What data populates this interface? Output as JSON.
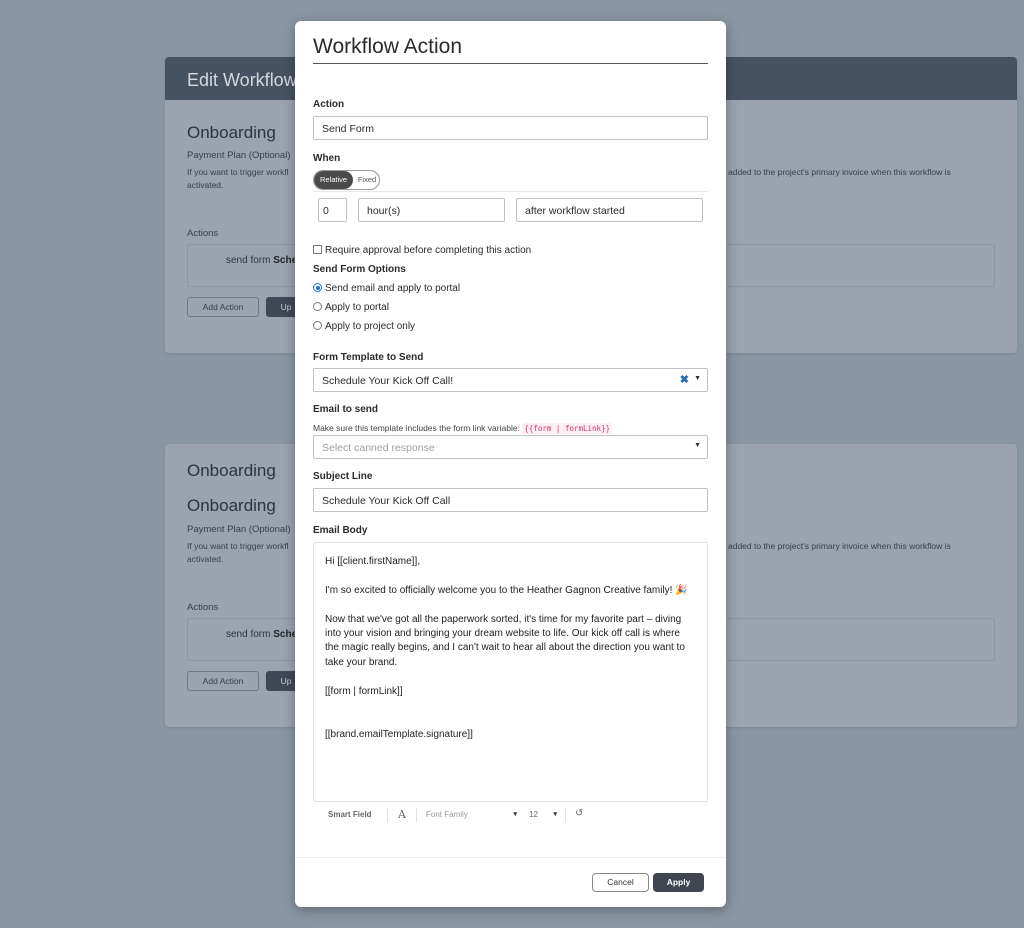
{
  "background": {
    "header_title": "Edit Workflow",
    "card1": {
      "title": "Onboarding",
      "payment_label": "Payment Plan (Optional)",
      "help_left_1": "If you want to trigger workfl",
      "help_left_2": "activated.",
      "help_right": "added to the project's primary invoice when this workflow is",
      "actions_label": "Actions",
      "action_prefix": "send form",
      "action_name": "Sche",
      "add_action": "Add Action",
      "update_button": "Up"
    },
    "card2": {
      "title_top": "Onboarding",
      "title": "Onboarding",
      "payment_label": "Payment Plan (Optional)",
      "help_left_1": "If you want to trigger workfl",
      "help_left_2": "activated.",
      "help_right": "added to the project's primary invoice when this workflow is",
      "actions_label": "Actions",
      "action_prefix": "send form",
      "action_name": "Sche",
      "add_action": "Add Action",
      "update_button": "Up"
    }
  },
  "modal": {
    "title": "Workflow Action",
    "action": {
      "label": "Action",
      "value": "Send Form"
    },
    "when": {
      "label": "When",
      "toggle_active": "Relative",
      "toggle_inactive": "Fixed",
      "amount": "0",
      "unit": "hour(s)",
      "trigger": "after workflow started"
    },
    "require_approval": {
      "label": "Require approval before completing this action",
      "checked": false
    },
    "send_form_options": {
      "label": "Send Form Options",
      "options": [
        {
          "label": "Send email and apply to portal",
          "checked": true
        },
        {
          "label": "Apply to portal",
          "checked": false
        },
        {
          "label": "Apply to project only",
          "checked": false
        }
      ]
    },
    "form_template": {
      "label": "Form Template to Send",
      "value": "Schedule Your Kick Off Call!",
      "clear_icon": "✖",
      "caret_icon": "▼"
    },
    "email_to_send": {
      "label": "Email to send",
      "hint": "Make sure this template includes the form link variable:",
      "hint_code": "{{form | formLink}}",
      "placeholder": "Select canned response",
      "caret_icon": "▼"
    },
    "subject": {
      "label": "Subject Line",
      "value": "Schedule Your Kick Off Call"
    },
    "email_body": {
      "label": "Email Body",
      "greeting": "Hi [[client.firstName]],",
      "para1": "I'm so excited to officially welcome you to the Heather Gagnon Creative family! 🎉",
      "para2_l1": "Now that we've got all the paperwork sorted, it's time for my favorite part – diving",
      "para2_l2": "into your vision and bringing your dream website to life. Our kick off call is where",
      "para2_l3": "the magic really begins, and I can't wait to hear all about the direction you want to",
      "para2_l4": "take your brand.",
      "form_link": "[[form | formLink]]",
      "signature": "[[brand.emailTemplate.signature]]"
    },
    "toolbar": {
      "smart_field": "Smart Field",
      "font_icon": "A",
      "font_family": "Font Family",
      "font_size": "12",
      "caret_icon": "▼",
      "undo_icon": "↺"
    },
    "buttons": {
      "cancel": "Cancel",
      "apply": "Apply"
    }
  },
  "colors": {
    "overlay": "#8a96a2",
    "header_dark": "#475261",
    "apply_button": "#3f4650",
    "radio_checked": "#1a73c9",
    "clear_icon": "#2d6db5",
    "code_text": "#d6336c"
  }
}
